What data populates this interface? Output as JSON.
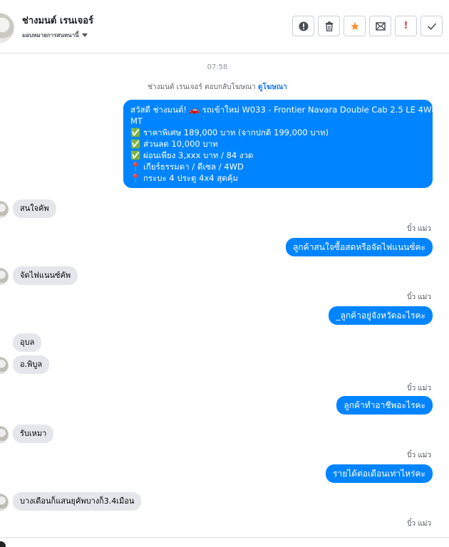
{
  "header": {
    "contact_name": "ช่างมนต์ เรนเจอร์",
    "assign_label": "มอบหมายการสนทนานี้",
    "tool_icons": {
      "info": "!",
      "trash": "🗑",
      "star": "★",
      "mail": "✉",
      "spam": "!",
      "done": "✓"
    }
  },
  "thread": {
    "timestamp": "07:58",
    "ad_reply_text": "ช่างมนต์ เรนเจอร์ ตอบกลับโฆษณา",
    "ad_reply_link": "ดูโฆษณา",
    "ad_message_lines": [
      "สวัสดี ช่างมนต์! 🚗 รถเข้าใหม่ W033 - Frontier Navara Double Cab 2.5 LE 4WD",
      "MT",
      "✅ ราคาพิเศษ 189,000 บาท (จากปกติ 199,000 บาท)",
      "✅ ส่วนลด 10,000 บาท",
      "✅ ผ่อนเพียง 3,xxx บาท / 84 งวด",
      "📍 เกียร์ธรรมดา / ดีเซล / 4WD",
      "📍 กระบะ 4 ประตู 4x4 สุดคุ้ม"
    ],
    "messages": [
      {
        "type": "in",
        "text": "สนใจคัพ"
      },
      {
        "type": "sender",
        "text": "บิ๋ว แม่ว"
      },
      {
        "type": "out",
        "text": "ลูกค้าสนใจซื้อสดหรือจัดไฟแนนซ์คะ"
      },
      {
        "type": "in",
        "text": "จัดไฟแนนซ์คัพ"
      },
      {
        "type": "sender",
        "text": "บิ๋ว แม่ว"
      },
      {
        "type": "out",
        "text": "_ลูกค้าอยู่จังหวัดอะไรคะ"
      },
      {
        "type": "in",
        "text": "อุบล"
      },
      {
        "type": "in",
        "text": "อ.พิบูล"
      },
      {
        "type": "sender",
        "text": "บิ๋ว แม่ว"
      },
      {
        "type": "out",
        "text": "ลูกค้าทำอาชีพอะไรคะ"
      },
      {
        "type": "in",
        "text": "รับเหมา"
      },
      {
        "type": "sender",
        "text": "บิ๋ว แม่ว"
      },
      {
        "type": "out",
        "text": "รายได้ต่อเดือนเท่าไหร่คะ"
      },
      {
        "type": "in",
        "text": "บางเดือนก็แสนยุคัพบางก็3.4เมือน"
      },
      {
        "type": "sender",
        "text": "บิ๋ว แม่ว"
      }
    ]
  },
  "colors": {
    "outgoing_bubble": "#0084ff",
    "incoming_bubble": "#e4e6eb",
    "link": "#1877f2",
    "star": "#f7923a",
    "spam": "#e03b3b"
  }
}
